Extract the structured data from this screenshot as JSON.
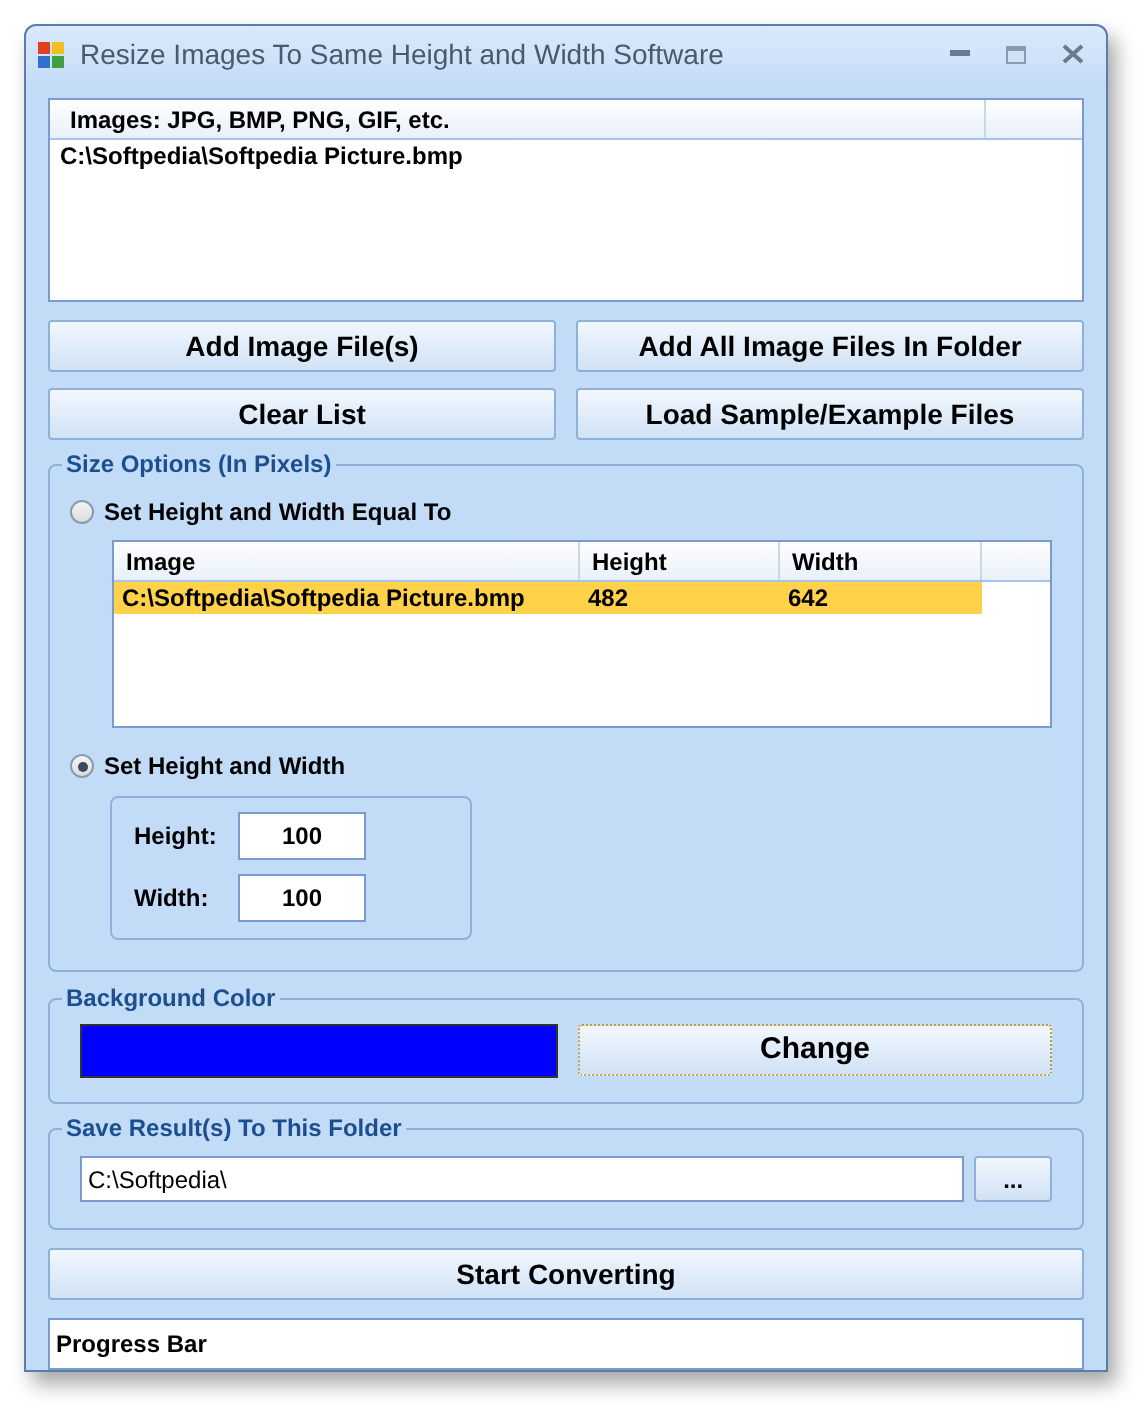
{
  "window": {
    "title": "Resize Images To Same Height and Width Software"
  },
  "file_list": {
    "column": "Images: JPG, BMP, PNG, GIF, etc.",
    "rows": [
      "C:\\Softpedia\\Softpedia Picture.bmp"
    ]
  },
  "buttons": [
    "Add Image File(s)",
    "Add All Image Files In Folder",
    "Clear List",
    "Load Sample/Example Files"
  ],
  "size_options": {
    "title": "Size Options (In Pixels)",
    "options": [
      {
        "label": "Set Height and Width Equal To",
        "selected": false
      },
      {
        "label": "Set Height and Width",
        "selected": true
      }
    ],
    "table": {
      "columns": [
        "Image",
        "Height",
        "Width"
      ],
      "rows": [
        {
          "cells": [
            "C:\\Softpedia\\Softpedia Picture.bmp",
            "482",
            "642"
          ],
          "selected": true
        }
      ]
    },
    "fields": [
      {
        "label": "Height:",
        "value": "100"
      },
      {
        "label": "Width:",
        "value": "100"
      }
    ]
  },
  "background_color": {
    "title": "Background Color",
    "color": "#0000ff",
    "button": "Change"
  },
  "save_folder": {
    "title": "Save Result(s) To This Folder",
    "value": "C:\\Softpedia\\",
    "button": "..."
  },
  "start_button": "Start Converting",
  "progress_bar": {
    "label": "Progress Bar"
  }
}
